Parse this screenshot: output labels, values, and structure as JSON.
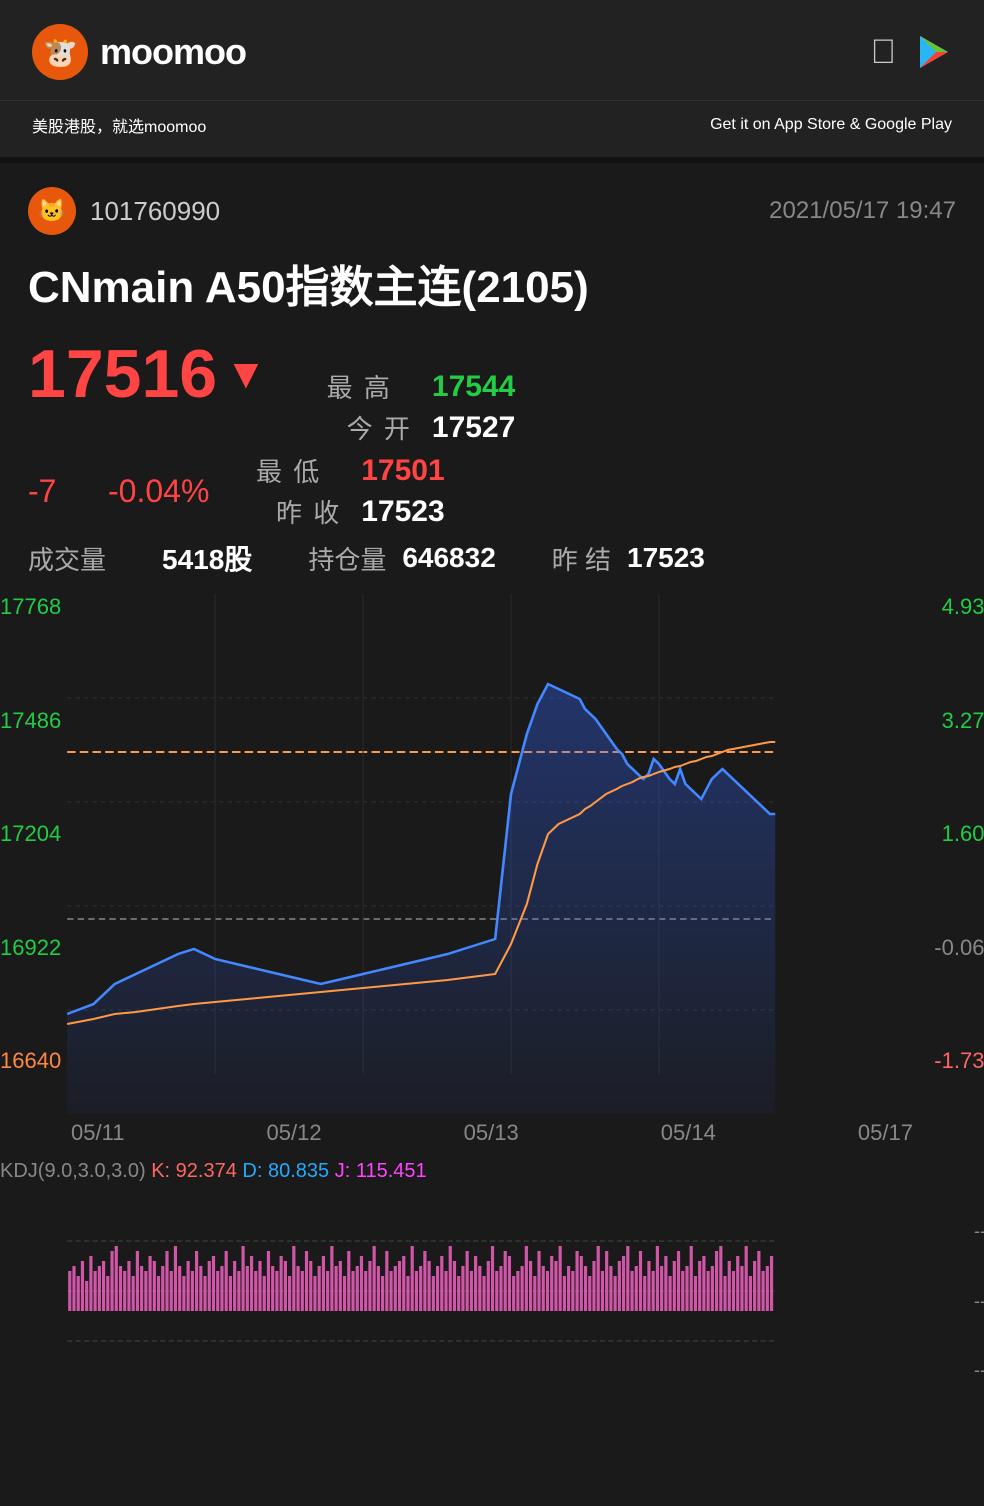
{
  "header": {
    "logo_text": "moomoo",
    "subtitle_left": "美股港股，就选moomoo",
    "subtitle_right": "Get it on App Store & Google Play"
  },
  "post": {
    "user_id": "101760990",
    "datetime": "2021/05/17  19:47"
  },
  "stock": {
    "title": "CNmain  A50指数主连(2105)",
    "current_price": "17516",
    "change_abs": "-7",
    "change_pct": "-0.04%",
    "high_label": "最  高",
    "high_value": "17544",
    "low_label": "最  低",
    "low_value": "17501",
    "open_label": "今  开",
    "open_value": "17527",
    "prev_close_label": "昨  收",
    "prev_close_value": "17523",
    "volume_label": "成交量",
    "volume_value": "5418股",
    "position_label": "持仓量",
    "position_value": "646832",
    "settlement_label": "昨  结",
    "settlement_value": "17523"
  },
  "chart": {
    "y_labels_left": [
      "17768",
      "17486",
      "17204",
      "16922",
      "16640"
    ],
    "y_labels_right": [
      "4.93%",
      "3.27%",
      "1.60%",
      "-0.06%",
      "-1.73%"
    ],
    "x_labels": [
      "05/11",
      "05/12",
      "05/13",
      "05/14",
      "05/17"
    ],
    "kdj_label": "KDJ(9.0,3.0,3.0)",
    "kdj_k_label": "K:",
    "kdj_k_value": "92.374",
    "kdj_d_label": "D:",
    "kdj_d_value": "80.835",
    "kdj_j_label": "J:",
    "kdj_j_value": "115.451"
  },
  "colors": {
    "bg": "#1a1a1a",
    "header_bg": "#222222",
    "price_up": "#22cc44",
    "price_down": "#ff4444",
    "accent_orange": "#e8580c",
    "chart_blue": "#4488ff",
    "chart_orange": "#ff9944",
    "chart_pink": "#ff66cc",
    "dashed_orange": "#ff9944",
    "dashed_gray": "#888888"
  }
}
